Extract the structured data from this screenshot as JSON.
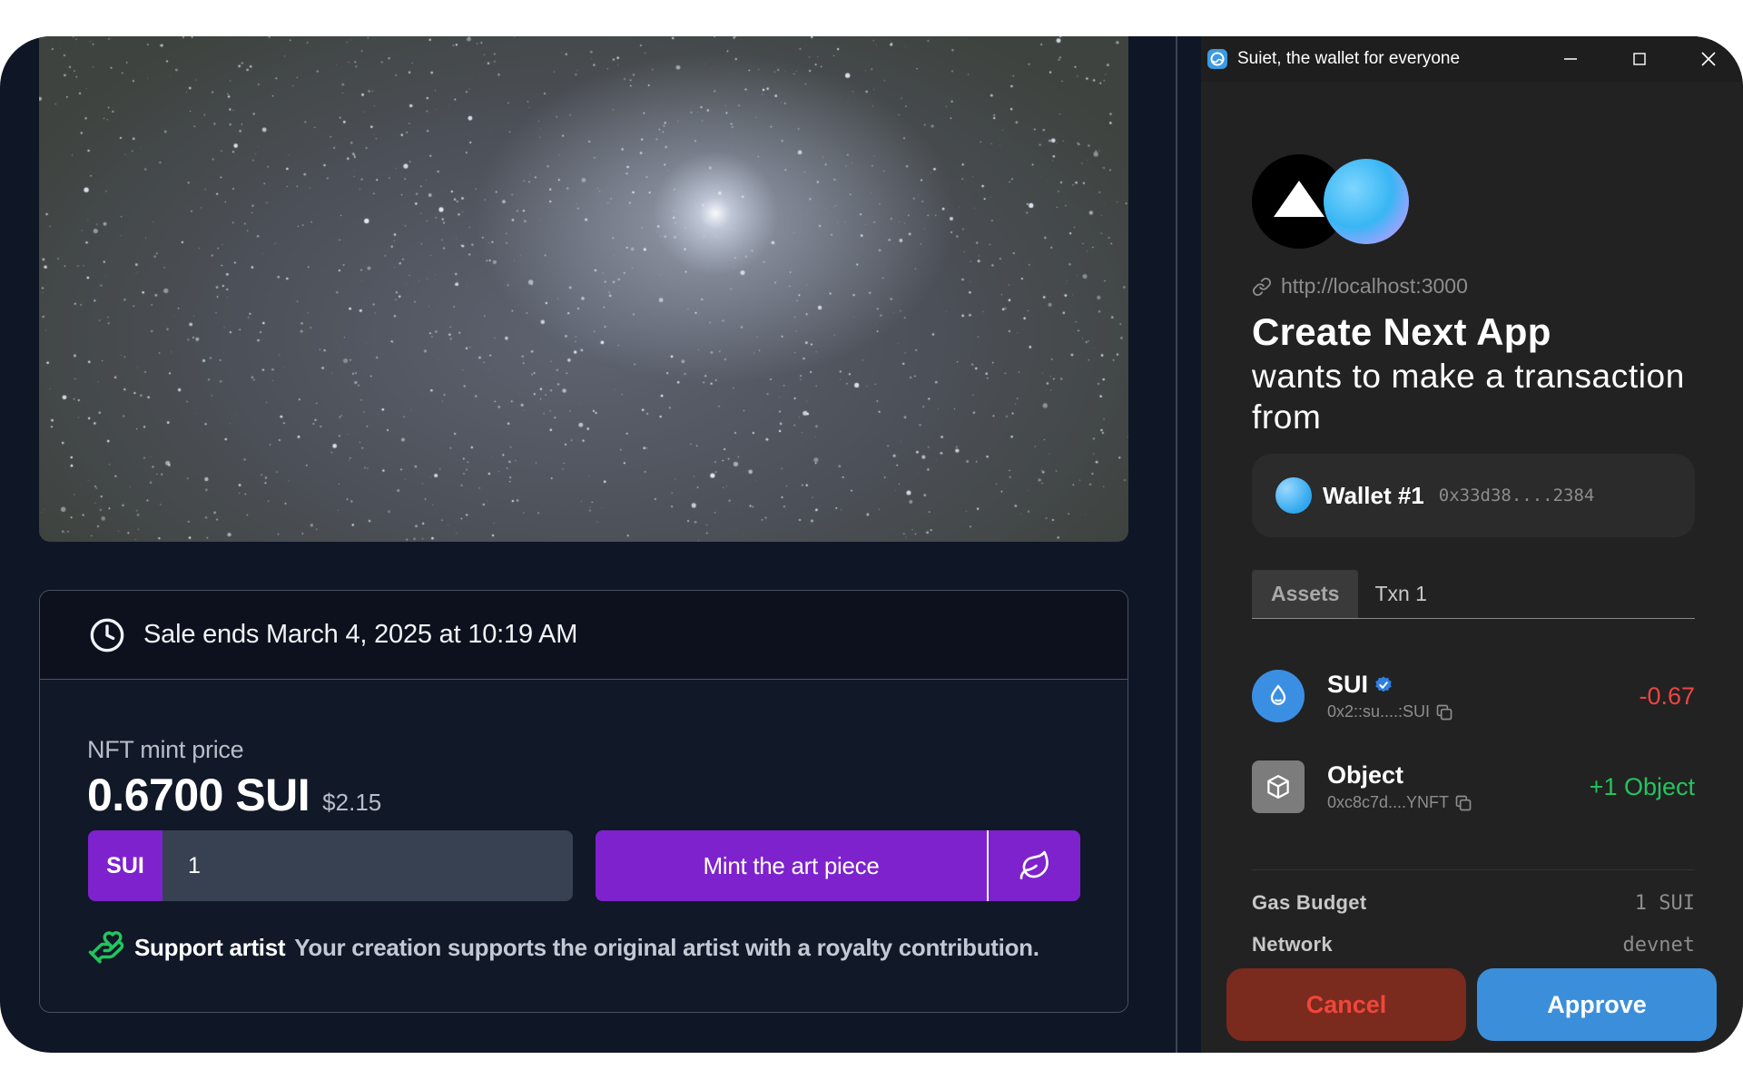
{
  "nft_page": {
    "hero_alt": "starfield",
    "sale_ends": "Sale ends March 4, 2025 at 10:19 AM",
    "mint_price_label": "NFT mint price",
    "price_value": "0.6700 SUI",
    "price_usd": "$2.15",
    "quantity_currency": "SUI",
    "quantity_value": "1",
    "mint_button_label": "Mint the art piece",
    "support_strong": "Support artist",
    "support_text": "Your creation supports the original artist with a royalty contribution.",
    "accent_color": "#7e22ce",
    "support_icon_color": "#22c55e"
  },
  "wallet_popup": {
    "window_title": "Suiet, the wallet for everyone",
    "dapp_url": "http://localhost:3000",
    "dapp_name": "Create Next App",
    "request_text": "wants to make a transaction from",
    "wallet_name": "Wallet #1",
    "wallet_address": "0x33d38....2384",
    "tabs": [
      {
        "label": "Assets",
        "active": true
      },
      {
        "label": "Txn 1",
        "active": false
      }
    ],
    "assets": [
      {
        "name": "SUI",
        "verified": true,
        "address": "0x2::su....:SUI",
        "change": "-0.67",
        "change_color": "#ef4444",
        "icon": "sui-droplet-icon"
      },
      {
        "name": "Object",
        "verified": false,
        "address": "0xc8c7d....YNFT",
        "change": "+1 Object",
        "change_color": "#22c55e",
        "icon": "cube-icon"
      }
    ],
    "details": [
      {
        "label": "Gas Budget",
        "value": "1 SUI"
      },
      {
        "label": "Network",
        "value": "devnet"
      }
    ],
    "cancel_label": "Cancel",
    "approve_label": "Approve"
  }
}
